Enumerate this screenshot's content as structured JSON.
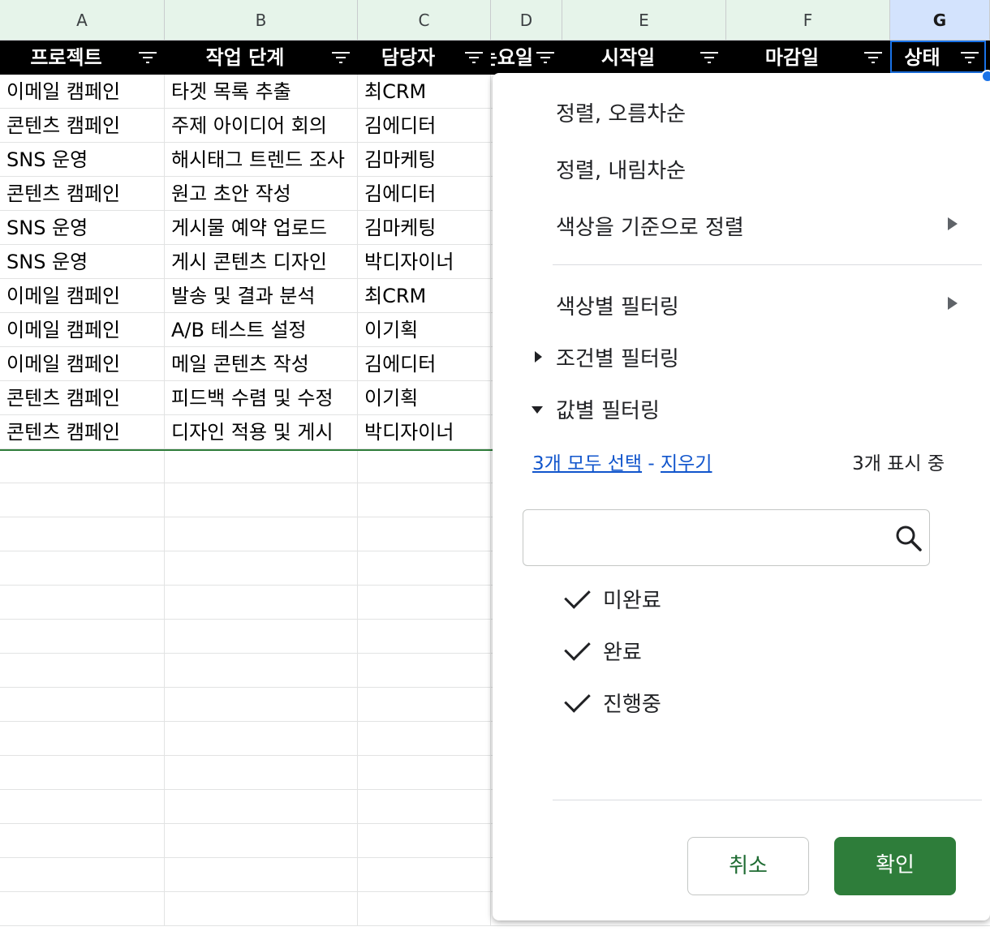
{
  "columns": [
    "A",
    "B",
    "C",
    "D",
    "E",
    "F",
    "G"
  ],
  "header": [
    "프로젝트",
    "작업 단계",
    "담당자",
    "는요일",
    "시작일",
    "마감일",
    "상태"
  ],
  "rows": [
    [
      "이메일 캠페인",
      "타겟 목록 추출",
      "최CRM"
    ],
    [
      "콘텐츠 캠페인",
      "주제 아이디어 회의",
      "김에디터"
    ],
    [
      "SNS 운영",
      "해시태그 트렌드 조사",
      "김마케팅"
    ],
    [
      "콘텐츠 캠페인",
      "원고 초안 작성",
      "김에디터"
    ],
    [
      "SNS 운영",
      "게시물 예약 업로드",
      "김마케팅"
    ],
    [
      "SNS 운영",
      "게시 콘텐츠 디자인",
      "박디자이너"
    ],
    [
      "이메일 캠페인",
      "발송 및 결과 분석",
      "최CRM"
    ],
    [
      "이메일 캠페인",
      "A/B 테스트 설정",
      "이기획"
    ],
    [
      "이메일 캠페인",
      "메일 콘텐츠 작성",
      "김에디터"
    ],
    [
      "콘텐츠 캠페인",
      "피드백 수렴 및 수정",
      "이기획"
    ],
    [
      "콘텐츠 캠페인",
      "디자인 적용 및 게시",
      "박디자이너"
    ]
  ],
  "menu": {
    "sort_asc": "정렬, 오름차순",
    "sort_desc": "정렬, 내림차순",
    "sort_by_color": "색상을 기준으로 정렬",
    "filter_by_color": "색상별 필터링",
    "filter_by_condition": "조건별 필터링",
    "filter_by_values": "값별 필터링",
    "select_all": "3개 모두 선택",
    "separator": "-",
    "clear": "지우기",
    "showing": "3개 표시 중",
    "values": [
      "미완료",
      "완료",
      "진행중"
    ],
    "cancel": "취소",
    "ok": "확인"
  },
  "colors": {
    "accent": "#2e7d3a",
    "link": "#1155cc",
    "selection": "#1a73e8"
  }
}
